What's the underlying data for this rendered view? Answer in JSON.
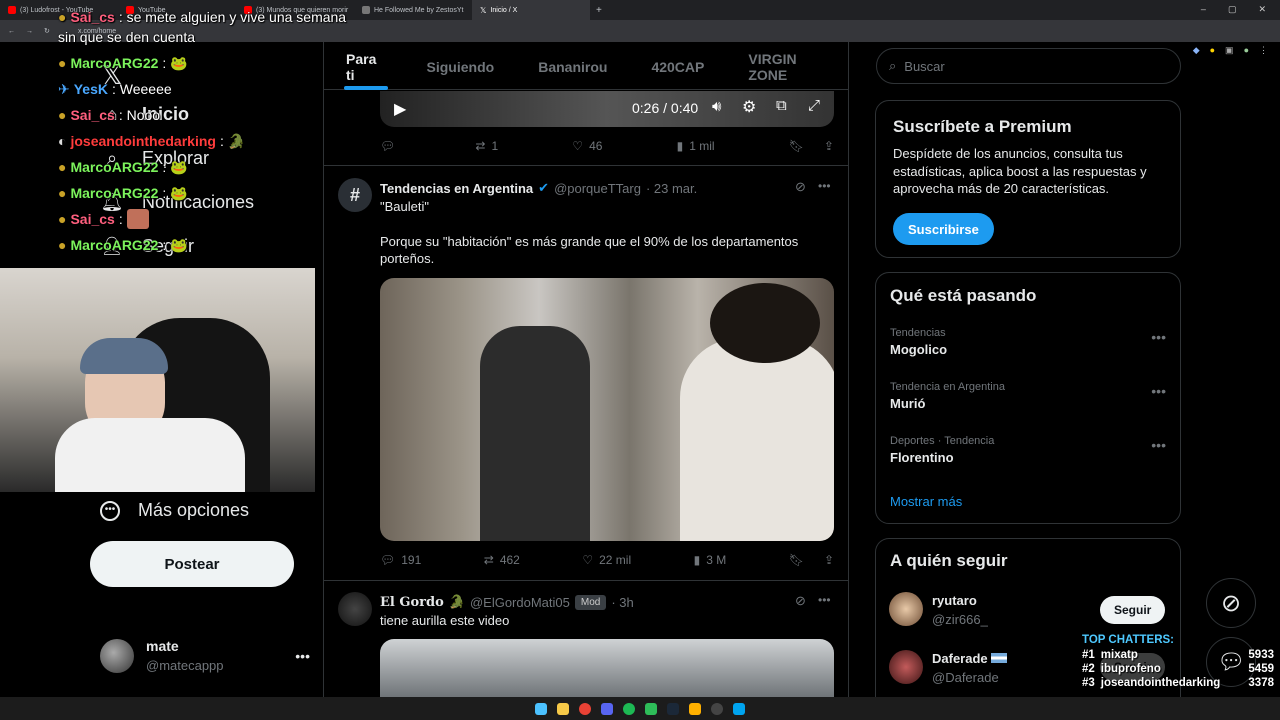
{
  "browser": {
    "tabs": [
      {
        "label": "(3) Ludofrost - YouTube",
        "color": "#ff0000"
      },
      {
        "label": "YouTube",
        "color": "#ff0000"
      },
      {
        "label": "(3) Mundos que quieren morir",
        "color": "#ff0000"
      },
      {
        "label": "He Followed Me by ZestosYt",
        "color": "#777777"
      },
      {
        "label": "Inicio / X",
        "color": "#ffffff"
      }
    ],
    "url": "x.com/home"
  },
  "nav": {
    "home": "Inicio",
    "explore": "Explorar",
    "notifications": "Notificaciones",
    "follow": "Seguir",
    "more": "Más opciones",
    "post_button": "Postear",
    "user_name": "mate",
    "user_handle": "@matecappp"
  },
  "timeline": {
    "tabs": [
      "Para ti",
      "Siguiendo",
      "Bananirou",
      "420CAP",
      "VIRGIN ZONE"
    ],
    "video_time": "0:26 / 0:40",
    "first_actions": {
      "replies": "",
      "reposts": "1",
      "likes": "46",
      "views": "1 mil"
    },
    "tweet2": {
      "name": "Tendencias en Argentina",
      "handle": "@porqueTTarg",
      "date": "· 23 mar.",
      "line1": "\"Bauleti\"",
      "line2": "Porque su \"habitación\" es más grande que el 90% de los departamentos porteños.",
      "replies": "191",
      "reposts": "462",
      "likes": "22 mil",
      "views": "3 M"
    },
    "tweet3": {
      "name": "El Gordo",
      "handle": "@ElGordoMati05",
      "badge": "Mod",
      "time": "· 3h",
      "text": "tiene aurilla este video"
    }
  },
  "sidebar": {
    "search_placeholder": "Buscar",
    "premium": {
      "title": "Suscríbete a Premium",
      "body": "Despídete de los anuncios, consulta tus estadísticas, aplica boost a las respuestas y aprovecha más de 20 características.",
      "button": "Suscribirse"
    },
    "trends_title": "Qué está pasando",
    "trends": [
      {
        "category": "Tendencias",
        "name": "Mogolico"
      },
      {
        "category": "Tendencia en Argentina",
        "name": "Murió"
      },
      {
        "category": "Deportes · Tendencia",
        "name": "Florentino"
      }
    ],
    "show_more": "Mostrar más",
    "who_to_follow_title": "A quién seguir",
    "follow_suggestions": [
      {
        "name": "ryutaro",
        "handle": "@zir666_",
        "button": "Seguir"
      },
      {
        "name": "Daferade",
        "handle": "@Daferade",
        "button": "Seguir"
      }
    ]
  },
  "stream_chat": [
    {
      "user": "Sai_cs",
      "color": "#ff5f7e",
      "text": ": se mete alguien y vive una semana"
    },
    {
      "user": "",
      "color": "#ffffff",
      "text": "sin que se den cuenta"
    },
    {
      "user": "MarcoARG22",
      "color": "#7cf35c",
      "text": ": 🐸"
    },
    {
      "user": "YesK",
      "color": "#4aa8ff",
      "text": ": Weeeee"
    },
    {
      "user": "Sai_cs",
      "color": "#ff5f7e",
      "text": ": Nooo"
    },
    {
      "user": "joseandointhedarking",
      "color": "#ff3c3c",
      "text": ": 🐊"
    },
    {
      "user": "MarcoARG22",
      "color": "#7cf35c",
      "text": ": 🐸"
    },
    {
      "user": "MarcoARG22",
      "color": "#7cf35c",
      "text": ": 🐸"
    },
    {
      "user": "Sai_cs",
      "color": "#ff5f7e",
      "text": ":"
    },
    {
      "user": "MarcoARG22",
      "color": "#7cf35c",
      "text": ": 🐸"
    }
  ],
  "top_chatters": {
    "title": "TOP CHATTERS:",
    "rows": [
      {
        "rank": "#1",
        "name": "mixatp",
        "count": "5933"
      },
      {
        "rank": "#2",
        "name": "ibuprofeno",
        "count": "5459"
      },
      {
        "rank": "#3",
        "name": "joseandointhedarking",
        "count": "3378"
      }
    ]
  },
  "colors": {
    "accent": "#1d9bf0",
    "bg": "#000000",
    "border": "#2f3336",
    "muted": "#71767b"
  }
}
